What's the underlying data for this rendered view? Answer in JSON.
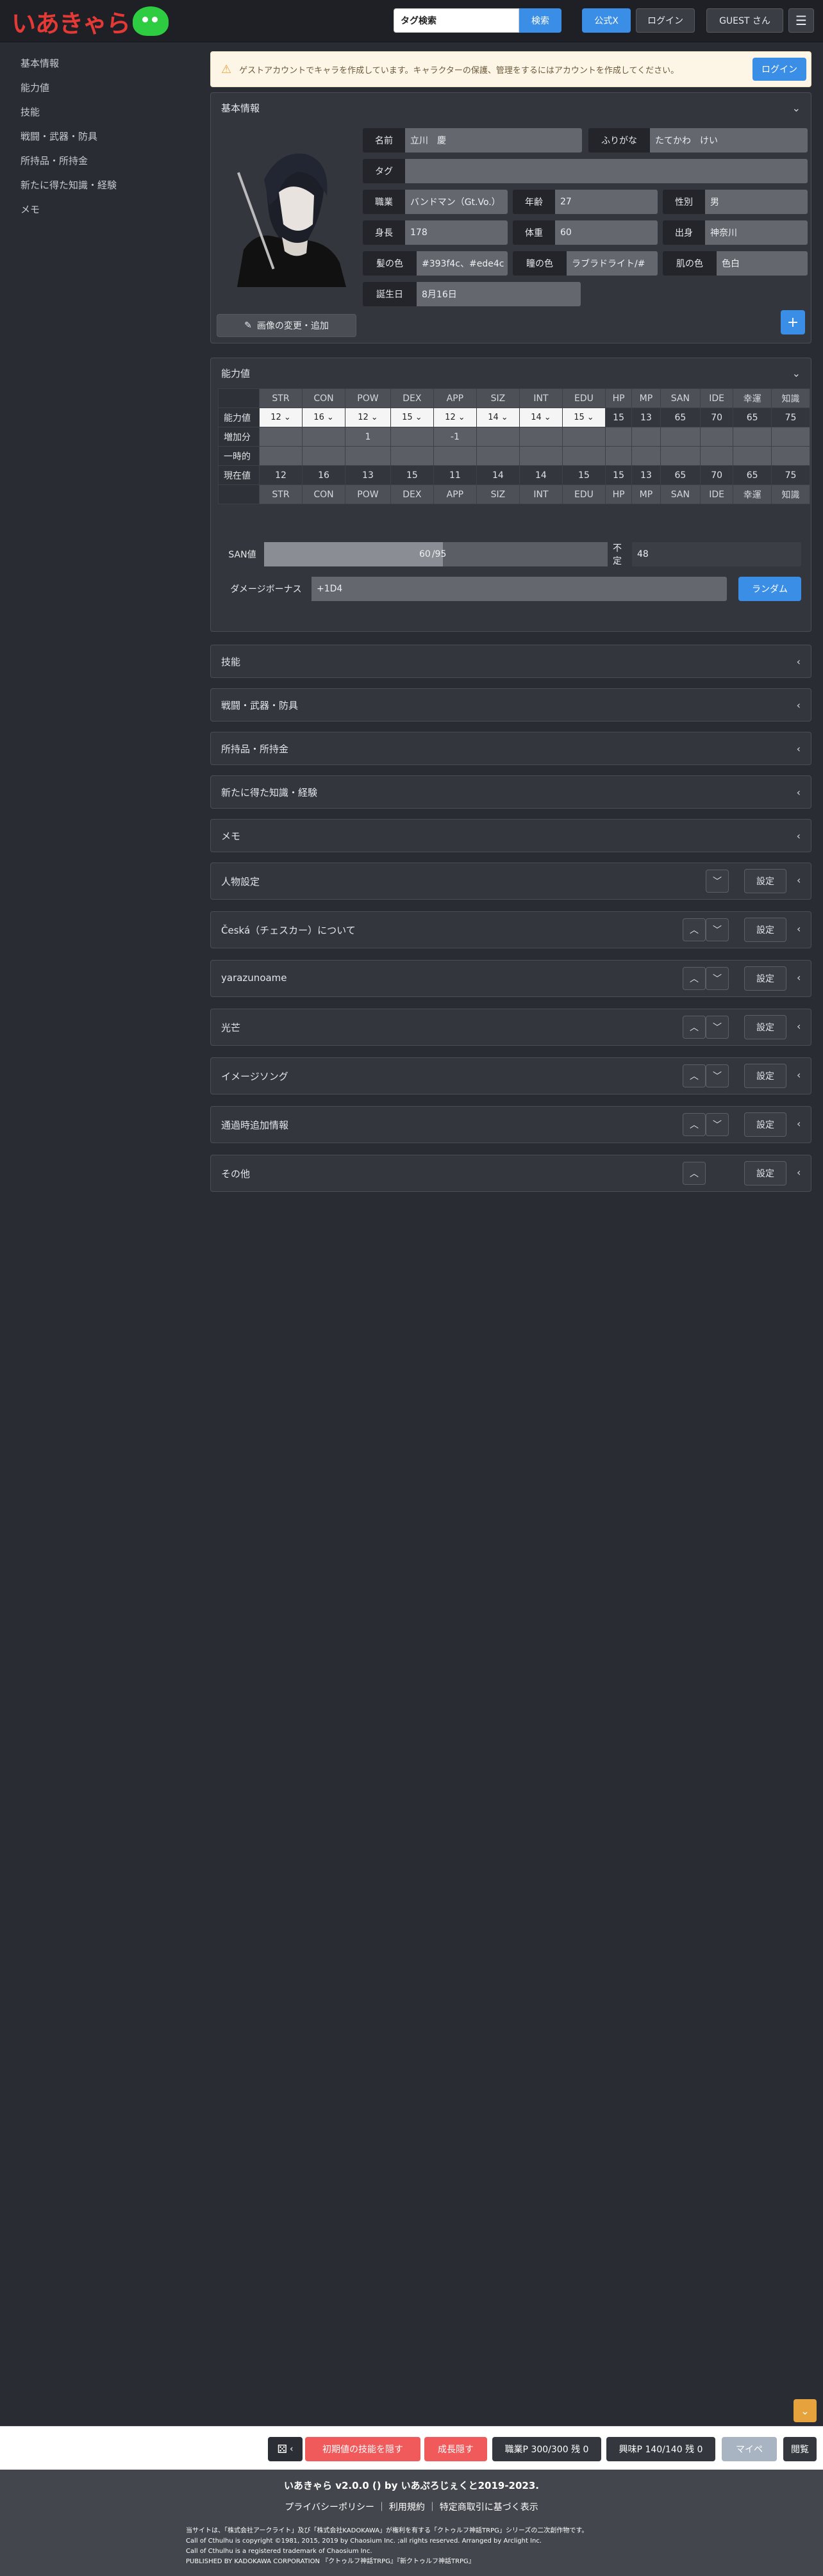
{
  "header": {
    "logo_text": "いあきゃら",
    "search_value": "タグ検索",
    "search_button": "検索",
    "official_x": "公式X",
    "login": "ログイン",
    "guest": "GUEST さん",
    "menu_icon": "hamburger-icon"
  },
  "sidebar": {
    "items": [
      "基本情報",
      "能力値",
      "技能",
      "戦闘・武器・防具",
      "所持品・所持金",
      "新たに得た知識・経験",
      "メモ"
    ]
  },
  "notice": {
    "text": "ゲストアカウントでキャラを作成しています。キャラクターの保護、管理をするにはアカウントを作成してください。",
    "login": "ログイン"
  },
  "basic": {
    "title": "基本情報",
    "fields": {
      "name_label": "名前",
      "name": "立川　慶",
      "furigana_label": "ふりがな",
      "furigana": "たてかわ　けい",
      "tag_label": "タグ",
      "tag": "",
      "job_label": "職業",
      "job": "バンドマン（Gt.Vo.）",
      "age_label": "年齢",
      "age": "27",
      "sex_label": "性別",
      "sex": "男",
      "height_label": "身長",
      "height": "178",
      "weight_label": "体重",
      "weight": "60",
      "origin_label": "出身",
      "origin": "神奈川",
      "hair_label": "髪の色",
      "hair": "#393f4c、#ede4c",
      "eye_label": "瞳の色",
      "eye": "ラブラドライト/#",
      "skin_label": "肌の色",
      "skin": "色白",
      "birthday_label": "誕生日",
      "birthday": "8月16日"
    },
    "image_button": "画像の変更・追加",
    "plus": "+"
  },
  "abilities": {
    "title": "能力値",
    "columns": [
      "STR",
      "CON",
      "POW",
      "DEX",
      "APP",
      "SIZ",
      "INT",
      "EDU",
      "HP",
      "MP",
      "SAN",
      "IDE",
      "幸運",
      "知識"
    ],
    "row_labels": [
      "能力値",
      "増加分",
      "一時的",
      "現在値"
    ],
    "base": [
      "12",
      "16",
      "12",
      "15",
      "12",
      "14",
      "14",
      "15",
      "15",
      "13",
      "65",
      "70",
      "65",
      "75"
    ],
    "increase": [
      "",
      "",
      "1",
      "",
      "-1",
      "",
      "",
      "",
      "",
      "",
      "",
      "",
      "",
      ""
    ],
    "current": [
      "12",
      "16",
      "13",
      "15",
      "11",
      "14",
      "14",
      "15",
      "15",
      "13",
      "65",
      "70",
      "65",
      "75"
    ],
    "san_label": "SAN値",
    "san_value": "60",
    "san_max": "/95",
    "fumei_label": "不定",
    "fumei_value": "48",
    "damage_label": "ダメージボーナス",
    "damage_value": "+1D4",
    "random_button": "ランダム"
  },
  "sections": [
    "技能",
    "戦闘・武器・防具",
    "所持品・所持金",
    "新たに得た知識・経験",
    "メモ"
  ],
  "custom_sections": [
    "人物設定",
    "Česká（チェスカー）について",
    "yarazunoame",
    "光芒",
    "イメージソング",
    "通過時追加情報",
    "その他"
  ],
  "settings_label": "設定",
  "bottombar": {
    "hide_initial": "初期値の技能を隠す",
    "hide_growth": "成長隠す",
    "job_points": "職業P 300/300 残 0",
    "interest_points": "興味P 140/140 残 0",
    "mypage": "マイペ",
    "view": "閲覧"
  },
  "footer": {
    "version": "いあきゃら v2.0.0 () by いあぷろじぇくと2019-2023.",
    "links": "プライバシーポリシー ｜ 利用規約 ｜ 特定商取引に基づく表示",
    "line1": "当サイトは、「株式会社アークライト」及び「株式会社KADOKAWA」が権利を有する「クトゥルフ神話TRPG」シリーズの二次創作物です。",
    "line2": "Call of Cthulhu is copyright ©1981, 2015, 2019 by Chaosium Inc. ;all rights reserved. Arranged by Arclight Inc.",
    "line3": "Call of Cthulhu is a registered trademark of Chaosium Inc.",
    "line4": "PUBLISHED BY KADOKAWA CORPORATION 『クトゥルフ神話TRPG』『新クトゥルフ神話TRPG』"
  }
}
